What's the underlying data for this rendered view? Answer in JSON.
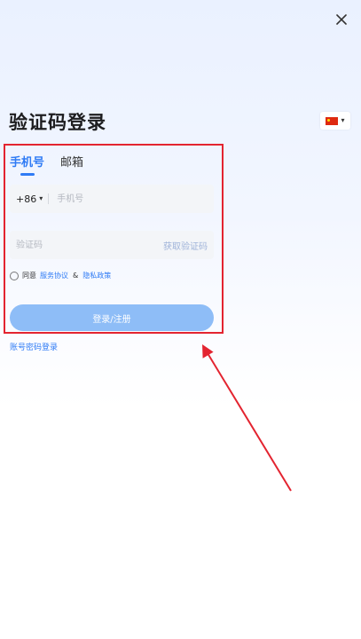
{
  "header": {
    "close_label": "×",
    "title": "验证码登录"
  },
  "lang": {
    "flag": "cn-flag",
    "caret": "▾"
  },
  "tabs": [
    {
      "label": "手机号",
      "active": true
    },
    {
      "label": "邮箱",
      "active": false
    }
  ],
  "phone": {
    "country_code": "+86",
    "caret": "▾",
    "placeholder": "手机号"
  },
  "code": {
    "placeholder": "验证码",
    "get_code": "获取验证码"
  },
  "agreement": {
    "prefix": "同意",
    "terms": "服务协议",
    "sep": "&",
    "privacy": "隐私政策"
  },
  "submit_label": "登录/注册",
  "alt_login": "账号密码登录",
  "colors": {
    "accent": "#2f7bf5",
    "button": "#8ebdf7",
    "annotation": "#e32430"
  }
}
